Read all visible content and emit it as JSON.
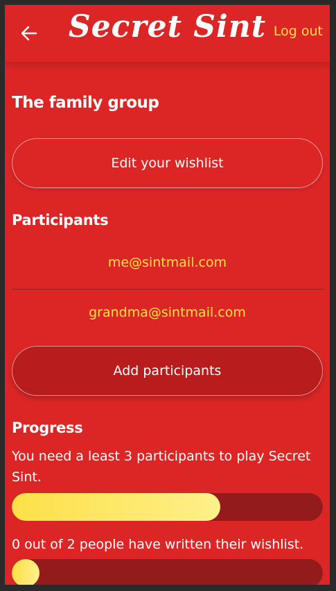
{
  "header": {
    "logo_text": "Secret Sint",
    "logout_label": "Log out",
    "back_icon": "arrow-left-icon"
  },
  "group": {
    "title": "The family group",
    "edit_wishlist_label": "Edit your wishlist"
  },
  "participants": {
    "title": "Participants",
    "items": [
      "me@sintmail.com",
      "grandma@sintmail.com"
    ],
    "add_label": "Add participants"
  },
  "progress": {
    "title": "Progress",
    "participants_text": "You need a least 3 participants to play Secret Sint.",
    "participants_progress": 0.67,
    "wishlist_text": "0 out of 2 people have written their wishlist.",
    "wishlist_progress": 0
  },
  "colors": {
    "background": "#dc2626",
    "accent": "#fde047",
    "bar_track": "#931b1b"
  }
}
